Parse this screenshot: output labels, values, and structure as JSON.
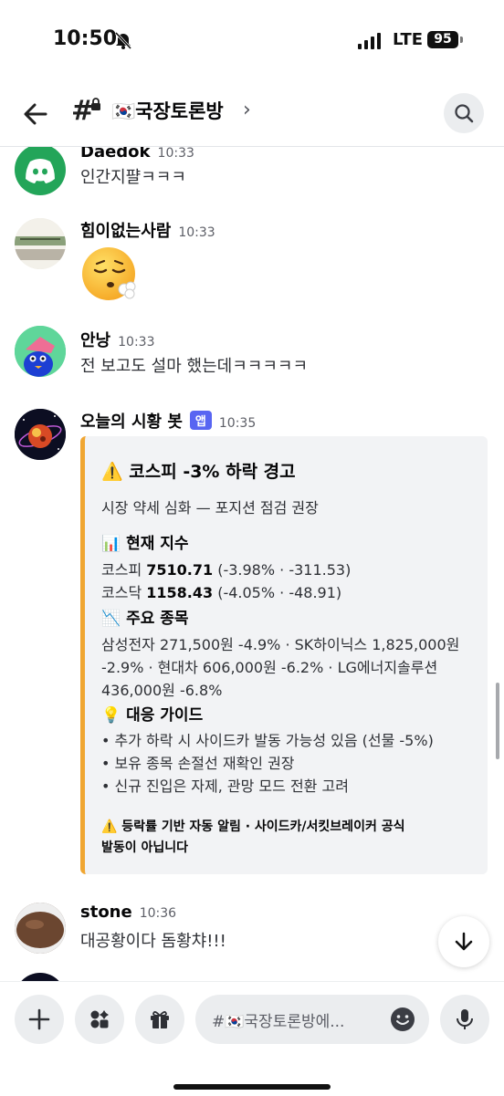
{
  "status_bar": {
    "time": "10:50",
    "network": "LTE",
    "battery": "95"
  },
  "header": {
    "channel_name": "🇰🇷국장토론방",
    "chevron": "›"
  },
  "messages": [
    {
      "author": "Daedok",
      "time": "10:33",
      "text": "인간지퍌ㅋㅋㅋ"
    },
    {
      "author": "힘이없는사람",
      "time": "10:33",
      "text": "😮‍💨"
    },
    {
      "author": "안낭",
      "time": "10:33",
      "text": "전 보고도 설마 했는데ㅋㅋㅋㅋㅋ"
    },
    {
      "author": "오늘의 시황 봇",
      "badge": "앱",
      "time": "10:35",
      "embed": {
        "title": "⚠️ 코스피 -3% 하락 경고",
        "subtitle": "시장 약세 심화 — 포지션 점검 권장",
        "section1_title": "📊 현재 지수",
        "kospi_label": "코스피 ",
        "kospi_value": "7510.71",
        "kospi_change": " (-3.98% · -311.53)",
        "kosdaq_label": "코스닥 ",
        "kosdaq_value": "1158.43",
        "kosdaq_change": " (-4.05% · -48.91)",
        "section2_title": "📉 주요 종목",
        "stocks_lines": [
          "삼성전자 271,500원 -4.9% · SK하이닉스 1,825,000원",
          "-2.9% · 현대차 606,000원 -6.2% · LG에너지솔루션",
          "436,000원 -6.8%"
        ],
        "section3_title": "💡 대응 가이드",
        "guide": [
          "• 추가 하락 시 사이드카 발동 가능성 있음 (선물 -5%)",
          "• 보유 종목 손절선 재확인 권장",
          "• 신규 진입은 자제, 관망 모드 전환 고려"
        ],
        "footer_lines": [
          "⚠️ 등락률 기반 자동 알림 · 사이드카/서킷브레이커 공식",
          "발동이 아닙니다"
        ]
      }
    },
    {
      "author": "stone",
      "time": "10:36",
      "text": "대공황이다 돔황챠!!!"
    }
  ],
  "composer": {
    "placeholder": "#🇰🇷국장토론방에..."
  },
  "colors": {
    "accent": "#5865f2",
    "embed_bar": "#f0a632",
    "discord_green": "#23a559"
  }
}
